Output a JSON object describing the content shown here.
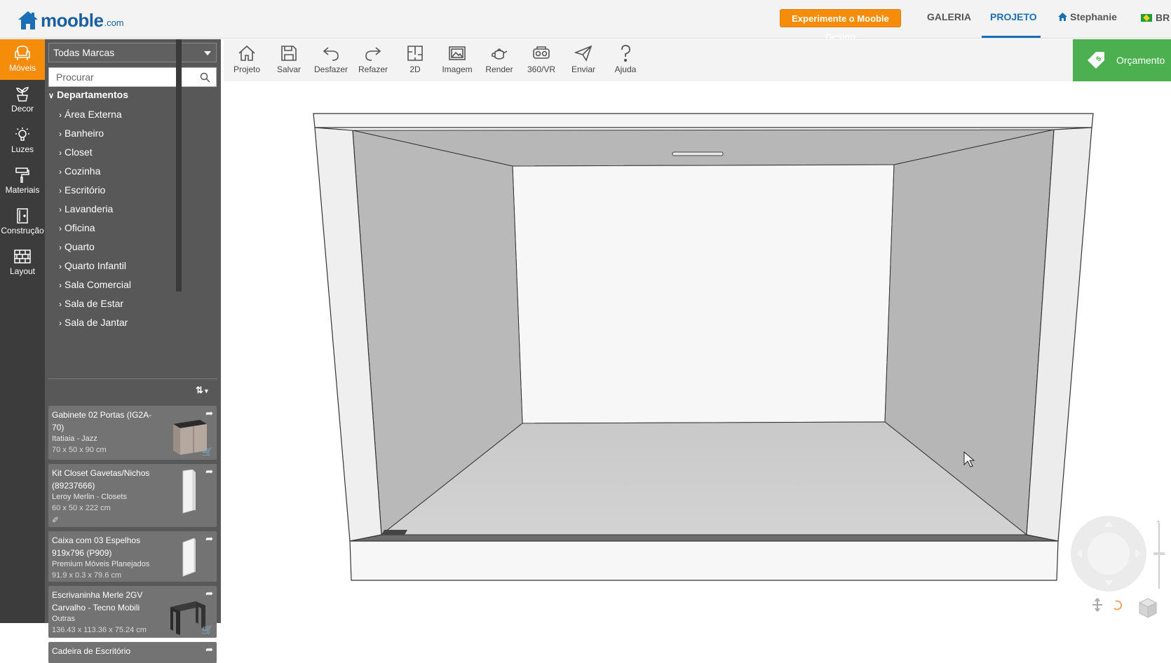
{
  "header": {
    "logo_word": "mooble",
    "logo_tld": ".com",
    "try_button": "Experimente o Mooble Design",
    "nav_galeria": "GALERIA",
    "nav_projeto": "PROJETO",
    "user_name": "Stephanie",
    "lang": "BR"
  },
  "rail": {
    "items": [
      {
        "label": "Móveis",
        "icon": "armchair-icon"
      },
      {
        "label": "Decor",
        "icon": "plant-icon"
      },
      {
        "label": "Luzes",
        "icon": "lightbulb-icon"
      },
      {
        "label": "Materiais",
        "icon": "paint-roller-icon"
      },
      {
        "label": "Construção",
        "icon": "door-icon"
      },
      {
        "label": "Layout",
        "icon": "brick-icon"
      }
    ]
  },
  "panel": {
    "brand_select": "Todas Marcas",
    "search_placeholder": "Procurar",
    "departments_title": "Departamentos",
    "departments": [
      "Área Externa",
      "Banheiro",
      "Closet",
      "Cozinha",
      "Escritório",
      "Lavanderia",
      "Oficina",
      "Quarto",
      "Quarto Infantil",
      "Sala Comercial",
      "Sala de Estar",
      "Sala de Jantar"
    ],
    "products": [
      {
        "name": "Gabinete 02 Portas (IG2A-70)",
        "brand": "Itatiaia - Jazz",
        "dims": "70 x 50 x 90 cm"
      },
      {
        "name": "Kit Closet Gavetas/Nichos (89237666)",
        "brand": "Leroy Merlin - Closets",
        "dims": "60 x 50 x 222 cm"
      },
      {
        "name": "Caixa com 03 Espelhos 919x796 (P909)",
        "brand": "Premium Móveis Planejados",
        "dims": "91.9 x 0.3 x 79.6 cm"
      },
      {
        "name": "Escrivaninha Merle 2GV Carvalho - Tecno Mobili",
        "brand": "Outras",
        "dims": "136.43 x 113.36 x 75.24 cm"
      },
      {
        "name": "Cadeira de Escritório",
        "brand": "",
        "dims": ""
      }
    ]
  },
  "toolbar": {
    "tools": [
      {
        "label": "Projeto",
        "icon": "home-icon"
      },
      {
        "label": "Salvar",
        "icon": "save-icon"
      },
      {
        "label": "Desfazer",
        "icon": "undo-icon"
      },
      {
        "label": "Refazer",
        "icon": "redo-icon"
      },
      {
        "label": "2D",
        "icon": "floorplan-icon"
      },
      {
        "label": "Imagem",
        "icon": "image-icon"
      },
      {
        "label": "Render",
        "icon": "teapot-icon"
      },
      {
        "label": "360/VR",
        "icon": "vr-headset-icon"
      },
      {
        "label": "Enviar",
        "icon": "send-icon"
      },
      {
        "label": "Ajuda",
        "icon": "help-icon"
      }
    ],
    "orcamento": "Orçamento"
  },
  "colors": {
    "accent_orange": "#f58d0b",
    "brand_blue": "#1a6fb5",
    "budget_green": "#4cb050",
    "rail_bg": "#3c3c3c",
    "panel_bg": "#585858"
  }
}
